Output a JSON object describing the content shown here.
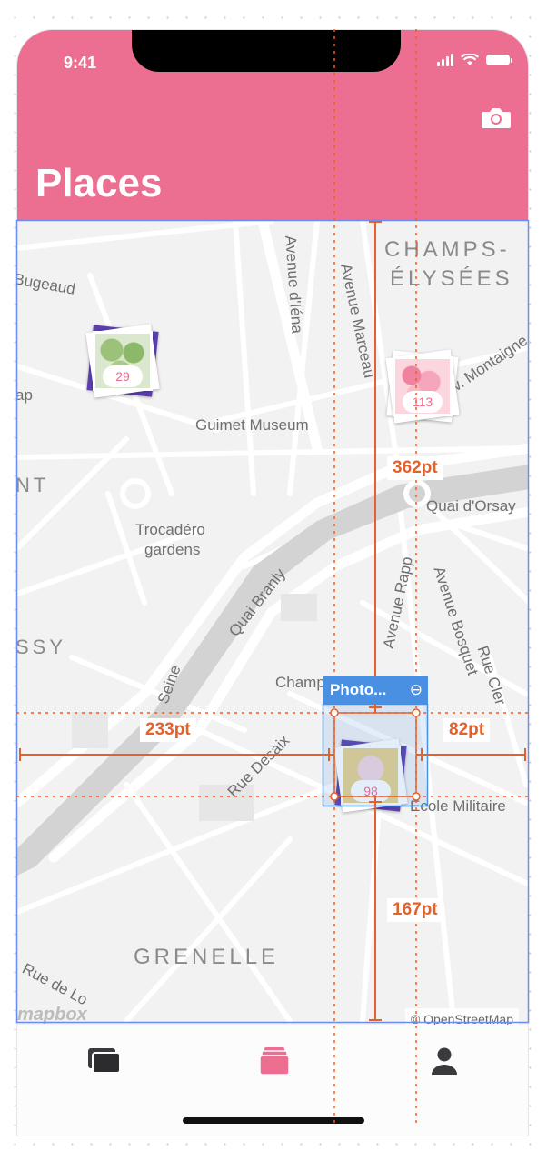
{
  "status_bar": {
    "time": "9:41"
  },
  "header": {
    "title": "Places"
  },
  "map": {
    "labels": {
      "champs1": "CHAMPS-",
      "champs2": "ÉLYSÉES",
      "bugeaud": "Bugeaud",
      "iena": "Avenue d'Iéna",
      "marceau": "Avenue Marceau",
      "montaigne": "Av. Montaigne",
      "guimet": "Guimet Museum",
      "nt": "NT",
      "quai_orsay": "Quai d'Orsay",
      "trocadero1": "Trocadéro",
      "trocadero2": "gardens",
      "quai_branly": "Quai Branly",
      "rapp": "Avenue Rapp",
      "bosquet": "Avenue Bosquet",
      "cler": "Rue Cler",
      "ssy": "SSY",
      "seine": "Seine",
      "champ": "Champ",
      "desaix": "Rue Desaix",
      "ecole": "École Militaire",
      "grenelle": "GRENELLE",
      "rue_de_lo": "Rue de Lo",
      "ap": "ap",
      "osm": "© OpenStreetMap",
      "mapbox": "mapbox"
    },
    "clusters": [
      {
        "id": "broccoli",
        "count": "29"
      },
      {
        "id": "balloons",
        "count": "113"
      },
      {
        "id": "icecream",
        "count": "98"
      }
    ]
  },
  "selection": {
    "label": "Photo...",
    "arrow": "⊖"
  },
  "measurements": {
    "top": "362pt",
    "left": "233pt",
    "right": "82pt",
    "bottom": "167pt"
  },
  "tabs": [
    {
      "name": "albums",
      "icon": "stack-icon"
    },
    {
      "name": "places",
      "icon": "cards-icon",
      "active": true
    },
    {
      "name": "profile",
      "icon": "person-icon"
    }
  ],
  "colors": {
    "accent": "#ec6e90",
    "measure": "#e3612b",
    "selection": "#4a90e2"
  }
}
